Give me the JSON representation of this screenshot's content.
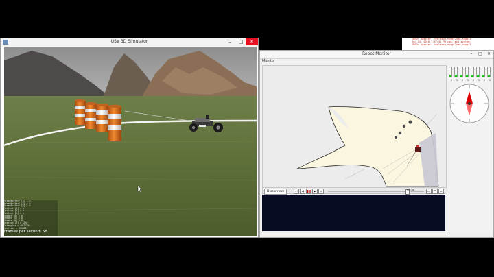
{
  "simulator": {
    "title": "USV 3D Simulator",
    "buttons": {
      "minimize": "–",
      "maximize": "□",
      "close": "✕"
    },
    "overlay_lines": [
      "FrameBufferF [K] = 0",
      "FrameBufferF [K] = 0",
      "FrameBufferF [K] = 0",
      "Texture [K] = 0",
      "Texture [K] = 0",
      "Texture [K] = 0",
      "Shader [K] = 0",
      "Shader [K] = 0",
      "Shader [K] = 0",
      "Uniform [K] = 1142",
      "Triangles = 4012779",
      "Vertices = 2114827"
    ],
    "fps_label": "Frames per second: 58",
    "colors": {
      "close_button": "#e81123",
      "terrain": "#5c6f3a",
      "sky": "#9a9a9a",
      "barrel_orange": "#e0761f"
    }
  },
  "monitor": {
    "title": "Robot Monitor",
    "buttons": {
      "minimize": "–",
      "maximize": "□",
      "close": "✕"
    },
    "menu_label": "Monitor",
    "controls": {
      "disconnect_label": "Disconnect",
      "playback_buttons": [
        {
          "icon": "skip-to-start-icon",
          "glyph": "⏮"
        },
        {
          "icon": "rewind-icon",
          "glyph": "◀"
        },
        {
          "icon": "pause-icon",
          "glyph": "❚❚"
        },
        {
          "icon": "forward-icon",
          "glyph": "▶"
        },
        {
          "icon": "skip-to-end-icon",
          "glyph": "⏭"
        }
      ],
      "time_label": "01:06",
      "right_buttons": [
        {
          "icon": "window-icon",
          "glyph": "▭"
        },
        {
          "icon": "collapse-icon",
          "glyph": "⌃"
        },
        {
          "icon": "expand-icon",
          "glyph": "⌄"
        }
      ],
      "seek_fraction": 0.82
    },
    "sensor_bars": [
      {
        "value": "0",
        "level": 0.2
      },
      {
        "value": "0",
        "level": 0.2
      },
      {
        "value": "0",
        "level": 0.2
      },
      {
        "value": "0",
        "level": 0.2
      },
      {
        "value": "0",
        "level": 0.2
      },
      {
        "value": "0",
        "level": 0.2
      },
      {
        "value": "0",
        "level": 0.2
      },
      {
        "value": "0",
        "level": 0.2
      }
    ],
    "colors": {
      "console_bg": "#070b24",
      "bar_fill": "#16c216",
      "map_region": "#fbf6df",
      "compass_needle": "#e00000"
    }
  },
  "log": {
    "lines": [
      "INFO: Adapter: nvoldsma,nvwgf2uma,nvwgf2",
      "Jun 14, 2016 7:47:41 PM com.jme3.system.",
      "INFO: Adapter: nvoldsma,nvwgf2uma,nvwgf2"
    ]
  }
}
